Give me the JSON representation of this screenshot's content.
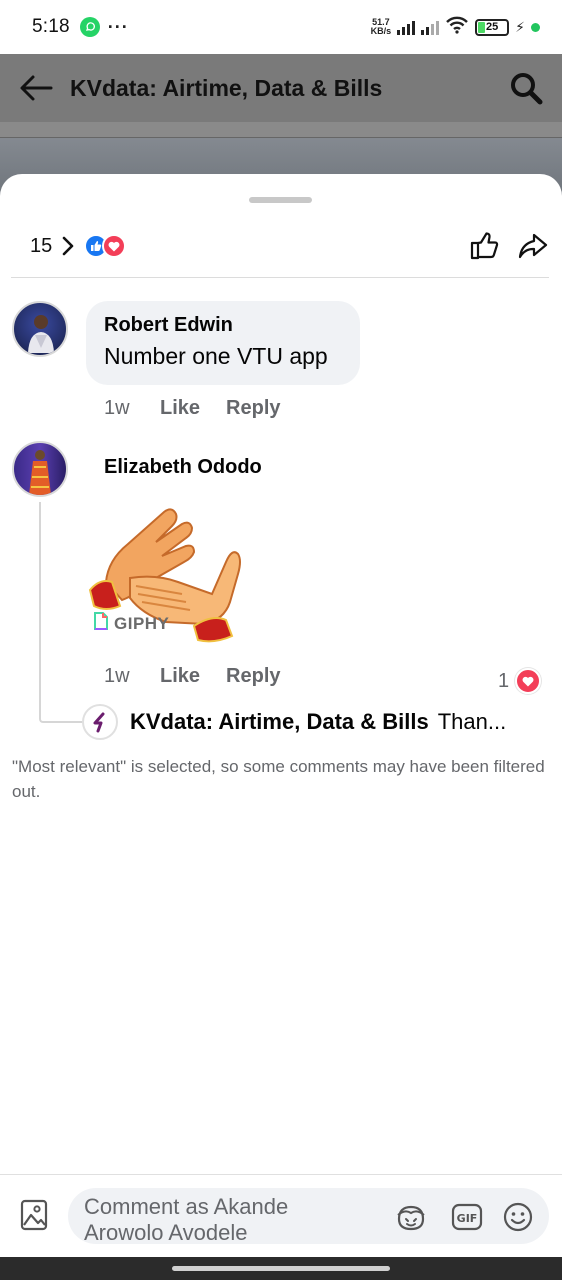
{
  "status_bar": {
    "time": "5:18",
    "dots": "···",
    "speed_value": "51.7",
    "speed_unit": "KB/s",
    "battery": "25"
  },
  "app_header": {
    "title": "KVdata: Airtime, Data & Bills"
  },
  "reactions": {
    "count": "15"
  },
  "comments": [
    {
      "name": "Robert Edwin",
      "text": "Number one VTU app",
      "time": "1w",
      "like_label": "Like",
      "reply_label": "Reply"
    },
    {
      "name": "Elizabeth Ododo",
      "gif_label": "GIPHY",
      "time": "1w",
      "like_label": "Like",
      "reply_label": "Reply",
      "reaction_count": "1",
      "reply": {
        "name": "KVdata: Airtime, Data & Bills",
        "text": "Than..."
      }
    }
  ],
  "filter_note": "\"Most relevant\" is selected, so some comments may have been filtered out.",
  "composer": {
    "placeholder": "Comment as Akande Arowolo Avodele"
  },
  "colors": {
    "like_blue": "#1877f2",
    "love_red": "#f33e58",
    "bubble_bg": "#f0f2f5",
    "muted_text": "#65676b"
  }
}
